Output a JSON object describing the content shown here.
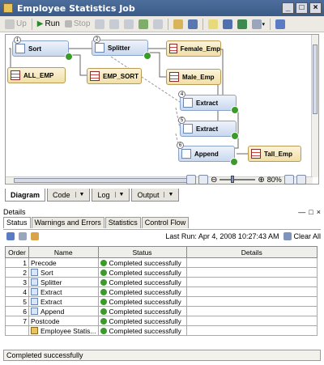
{
  "window": {
    "title": "Employee Statistics Job"
  },
  "toolbar": {
    "up": "Up",
    "run": "Run",
    "stop": "Stop"
  },
  "canvas": {
    "nodes": [
      {
        "label": "Sort",
        "step": "1"
      },
      {
        "label": "Splitter",
        "step": "2"
      },
      {
        "label": "Female_Emp"
      },
      {
        "label": "ALL_EMP"
      },
      {
        "label": "EMP_SORT"
      },
      {
        "label": "Male_Emp"
      },
      {
        "label": "Extract",
        "step": "4"
      },
      {
        "label": "Extract",
        "step": "5"
      },
      {
        "label": "Append",
        "step": "6"
      },
      {
        "label": "Tall_Emp"
      }
    ],
    "zoom": "80%"
  },
  "bottom_tabs": [
    "Diagram",
    "Code",
    "Log",
    "Output"
  ],
  "details": {
    "title": "Details",
    "tabs": [
      "Status",
      "Warnings and Errors",
      "Statistics",
      "Control Flow"
    ],
    "last_run": "Last Run: Apr 4, 2008 10:27:43 AM",
    "clear_all": "Clear All",
    "columns": [
      "Order",
      "Name",
      "Status",
      "Details"
    ],
    "rows": [
      {
        "order": "1",
        "name": "Precode",
        "status": "Completed successfully"
      },
      {
        "order": "2",
        "name": "Sort",
        "status": "Completed successfully"
      },
      {
        "order": "3",
        "name": "Splitter",
        "status": "Completed successfully"
      },
      {
        "order": "4",
        "name": "Extract",
        "status": "Completed successfully"
      },
      {
        "order": "5",
        "name": "Extract",
        "status": "Completed successfully"
      },
      {
        "order": "6",
        "name": "Append",
        "status": "Completed successfully"
      },
      {
        "order": "7",
        "name": "Postcode",
        "status": "Completed successfully"
      },
      {
        "order": "",
        "name": "Employee Statis...",
        "status": "Completed successfully"
      }
    ]
  },
  "statusbar": {
    "text": "Completed successfully"
  }
}
